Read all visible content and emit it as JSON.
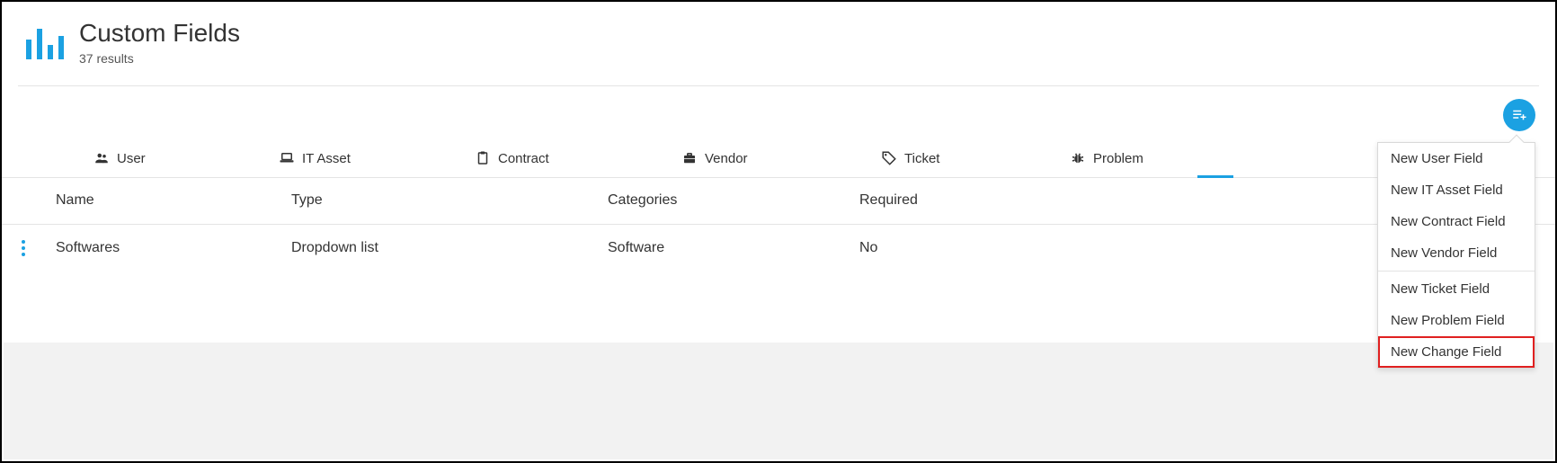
{
  "header": {
    "title": "Custom Fields",
    "subtitle": "37 results"
  },
  "tabs": {
    "user": {
      "label": "User"
    },
    "it_asset": {
      "label": "IT Asset"
    },
    "contract": {
      "label": "Contract"
    },
    "vendor": {
      "label": "Vendor"
    },
    "ticket": {
      "label": "Ticket"
    },
    "problem": {
      "label": "Problem"
    }
  },
  "columns": {
    "name": "Name",
    "type": "Type",
    "categories": "Categories",
    "required": "Required"
  },
  "rows": [
    {
      "name": "Softwares",
      "type": "Dropdown list",
      "categories": "Software",
      "required": "No"
    }
  ],
  "dropdown": {
    "group1": [
      "New User Field",
      "New IT Asset Field",
      "New Contract Field",
      "New Vendor Field"
    ],
    "group2": [
      "New Ticket Field",
      "New Problem Field",
      "New Change Field"
    ],
    "highlighted": "New Change Field"
  }
}
